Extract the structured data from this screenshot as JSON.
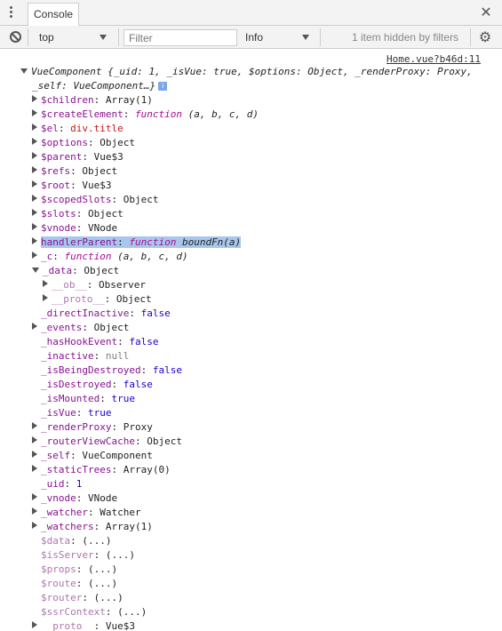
{
  "tabbar": {
    "tab_label": "Console"
  },
  "toolbar": {
    "context_value": "top",
    "filter_placeholder": "Filter",
    "level_value": "Info",
    "hidden_text": "1 item hidden by filters"
  },
  "log": {
    "source": "Home.vue?b46d:11",
    "summary_line1": "VueComponent {_uid: 1, _isVue: true, $options: Object, _renderProxy: Proxy,",
    "summary_line2": "_self: VueComponent…}",
    "info_badge": "i"
  },
  "props": [
    {
      "key": "$children",
      "value": "Array(1)",
      "vtype": "obj",
      "arrow": "right",
      "indent": 0
    },
    {
      "key": "$createElement",
      "value": "function (a, b, c, d)",
      "vtype": "fn",
      "arrow": "right",
      "indent": 0
    },
    {
      "key": "$el",
      "value": "div.title",
      "vtype": "str",
      "arrow": "right",
      "indent": 0
    },
    {
      "key": "$options",
      "value": "Object",
      "vtype": "obj",
      "arrow": "right",
      "indent": 0
    },
    {
      "key": "$parent",
      "value": "Vue$3",
      "vtype": "obj",
      "arrow": "right",
      "indent": 0
    },
    {
      "key": "$refs",
      "value": "Object",
      "vtype": "obj",
      "arrow": "right",
      "indent": 0
    },
    {
      "key": "$root",
      "value": "Vue$3",
      "vtype": "obj",
      "arrow": "right",
      "indent": 0
    },
    {
      "key": "$scopedSlots",
      "value": "Object",
      "vtype": "obj",
      "arrow": "right",
      "indent": 0
    },
    {
      "key": "$slots",
      "value": "Object",
      "vtype": "obj",
      "arrow": "right",
      "indent": 0
    },
    {
      "key": "$vnode",
      "value": "VNode",
      "vtype": "obj",
      "arrow": "right",
      "indent": 0
    },
    {
      "key": "handlerParent",
      "value": "function boundFn(a)",
      "vtype": "fn",
      "arrow": "right",
      "indent": 0,
      "highlight": true
    },
    {
      "key": "_c",
      "value": "function (a, b, c, d)",
      "vtype": "fn",
      "arrow": "right",
      "indent": 0
    },
    {
      "key": "_data",
      "value": "Object",
      "vtype": "obj",
      "arrow": "down",
      "indent": 0
    },
    {
      "key": "__ob__",
      "value": "Observer",
      "vtype": "obj",
      "arrow": "right",
      "indent": 1,
      "dim": true
    },
    {
      "key": "__proto__",
      "value": "Object",
      "vtype": "obj",
      "arrow": "right",
      "indent": 1,
      "dim": true
    },
    {
      "key": "_directInactive",
      "value": "false",
      "vtype": "bool",
      "arrow": "none",
      "indent": 0
    },
    {
      "key": "_events",
      "value": "Object",
      "vtype": "obj",
      "arrow": "right",
      "indent": 0
    },
    {
      "key": "_hasHookEvent",
      "value": "false",
      "vtype": "bool",
      "arrow": "none",
      "indent": 0
    },
    {
      "key": "_inactive",
      "value": "null",
      "vtype": "null",
      "arrow": "none",
      "indent": 0
    },
    {
      "key": "_isBeingDestroyed",
      "value": "false",
      "vtype": "bool",
      "arrow": "none",
      "indent": 0
    },
    {
      "key": "_isDestroyed",
      "value": "false",
      "vtype": "bool",
      "arrow": "none",
      "indent": 0
    },
    {
      "key": "_isMounted",
      "value": "true",
      "vtype": "bool",
      "arrow": "none",
      "indent": 0
    },
    {
      "key": "_isVue",
      "value": "true",
      "vtype": "bool",
      "arrow": "none",
      "indent": 0
    },
    {
      "key": "_renderProxy",
      "value": "Proxy",
      "vtype": "obj",
      "arrow": "right",
      "indent": 0
    },
    {
      "key": "_routerViewCache",
      "value": "Object",
      "vtype": "obj",
      "arrow": "right",
      "indent": 0
    },
    {
      "key": "_self",
      "value": "VueComponent",
      "vtype": "obj",
      "arrow": "right",
      "indent": 0
    },
    {
      "key": "_staticTrees",
      "value": "Array(0)",
      "vtype": "obj",
      "arrow": "right",
      "indent": 0
    },
    {
      "key": "_uid",
      "value": "1",
      "vtype": "bool",
      "arrow": "none",
      "indent": 0
    },
    {
      "key": "_vnode",
      "value": "VNode",
      "vtype": "obj",
      "arrow": "right",
      "indent": 0
    },
    {
      "key": "_watcher",
      "value": "Watcher",
      "vtype": "obj",
      "arrow": "right",
      "indent": 0
    },
    {
      "key": "_watchers",
      "value": "Array(1)",
      "vtype": "obj",
      "arrow": "right",
      "indent": 0
    },
    {
      "key": "$data",
      "value": "(...)",
      "vtype": "obj",
      "arrow": "none",
      "indent": 0,
      "dim": true
    },
    {
      "key": "$isServer",
      "value": "(...)",
      "vtype": "obj",
      "arrow": "none",
      "indent": 0,
      "dim": true
    },
    {
      "key": "$props",
      "value": "(...)",
      "vtype": "obj",
      "arrow": "none",
      "indent": 0,
      "dim": true
    },
    {
      "key": "$route",
      "value": "(...)",
      "vtype": "obj",
      "arrow": "none",
      "indent": 0,
      "dim": true
    },
    {
      "key": "$router",
      "value": "(...)",
      "vtype": "obj",
      "arrow": "none",
      "indent": 0,
      "dim": true
    },
    {
      "key": "$ssrContext",
      "value": "(...)",
      "vtype": "obj",
      "arrow": "none",
      "indent": 0,
      "dim": true
    },
    {
      "key": "__proto__",
      "value": "Vue$3",
      "vtype": "obj",
      "arrow": "right",
      "indent": 0,
      "dim": true
    }
  ],
  "colors": {
    "key": "#881391",
    "key_dim": "#ac76b0",
    "string": "#c41a16",
    "boolean": "#1c00cf",
    "null": "#808080",
    "highlight": "#a8c7ec",
    "toolbar_bg": "#f3f3f3"
  }
}
